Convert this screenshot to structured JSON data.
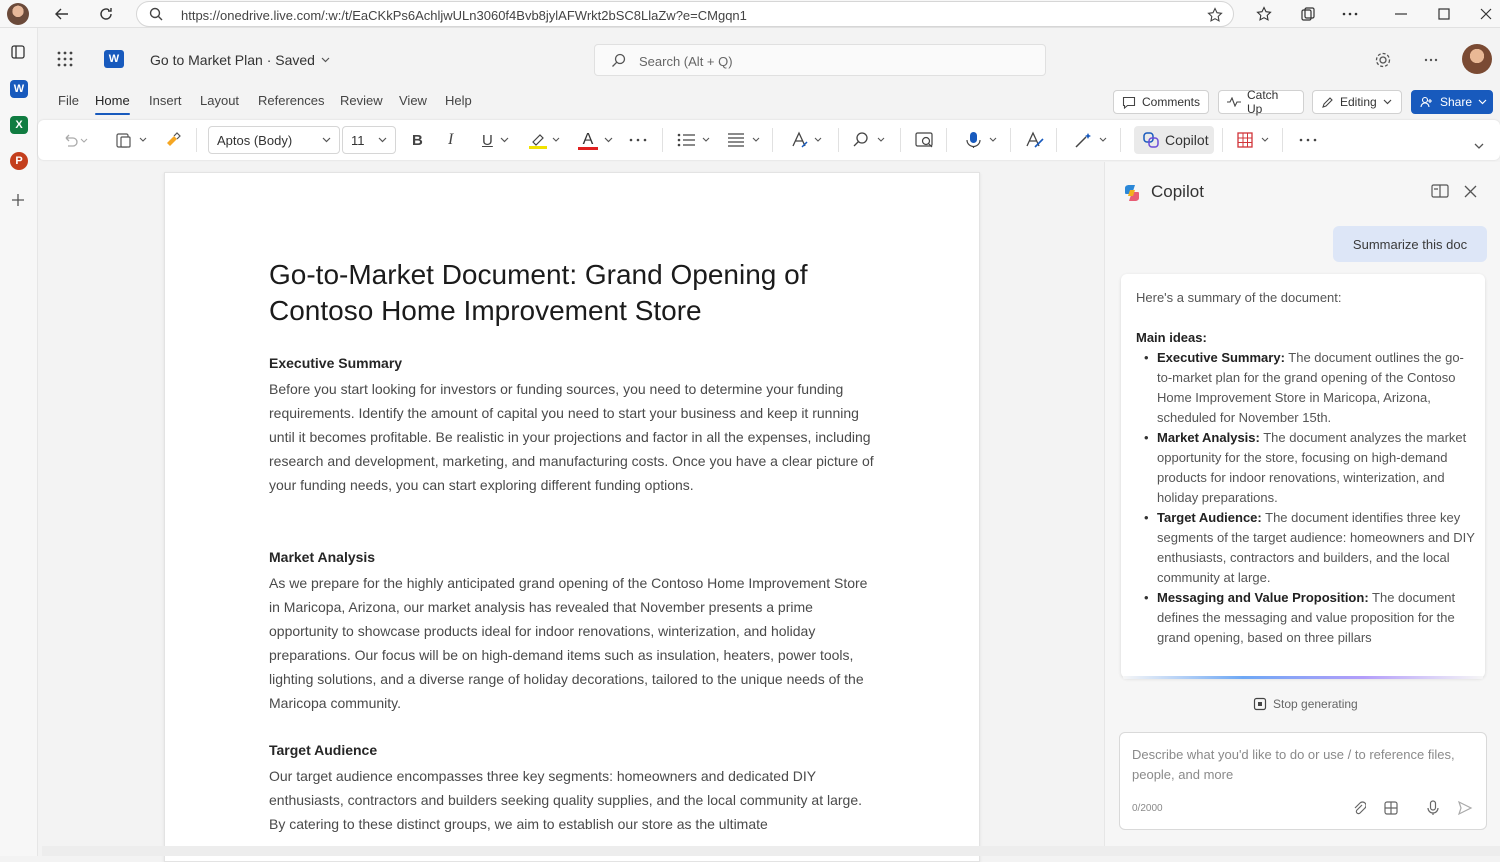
{
  "browser": {
    "url": "https://onedrive.live.com/:w:/t/EaCKkPs6AchljwULn3060f4Bvb8jylAFWrkt2bSC8LlaZw?e=CMgqn1"
  },
  "app": {
    "doc_title": "Go to Market Plan · Saved",
    "search_placeholder": "Search (Alt + Q)"
  },
  "menu": {
    "tabs": [
      "File",
      "Home",
      "Insert",
      "Layout",
      "References",
      "Review",
      "View",
      "Help"
    ],
    "active_tab": "Home",
    "comments": "Comments",
    "catchup": "Catch Up",
    "editing": "Editing",
    "share": "Share"
  },
  "ribbon": {
    "font": "Aptos (Body)",
    "size": "11",
    "bold": "B",
    "italic": "I",
    "underline": "U",
    "fontcolor": "A",
    "copilot": "Copilot"
  },
  "document": {
    "title": "Go-to-Market Document: Grand Opening of Contoso Home Improvement Store",
    "sections": [
      {
        "heading": "Executive Summary",
        "text": "Before you start looking for investors or funding sources, you need to determine your funding requirements. Identify the amount of capital you need to start your business and keep it running until it becomes profitable. Be realistic in your projections and factor in all the expenses, including research and development, marketing, and manufacturing costs. Once you have a clear picture of your funding needs, you can start exploring different funding options."
      },
      {
        "heading": "Market Analysis",
        "text": "As we prepare for the highly anticipated grand opening of the Contoso Home Improvement Store in Maricopa, Arizona, our market analysis has revealed that November presents a prime opportunity to showcase products ideal for indoor renovations, winterization, and holiday preparations. Our focus will be on high-demand items such as insulation, heaters, power tools, lighting solutions, and a diverse range of holiday decorations, tailored to the unique needs of the Maricopa community."
      },
      {
        "heading": "Target Audience",
        "text": "Our target audience encompasses three key segments: homeowners and dedicated DIY enthusiasts, contractors and builders seeking quality supplies, and the local community at large. By catering to these distinct groups, we aim to establish our store as the ultimate"
      }
    ]
  },
  "copilot": {
    "title": "Copilot",
    "prompt": "Summarize this doc",
    "intro": "Here's a summary of the document:",
    "main_ideas": "Main ideas:",
    "bullets": [
      {
        "label": "Executive Summary:",
        "text": " The document outlines the go-to-market plan for the grand opening of the Contoso Home Improvement Store in Maricopa, Arizona, scheduled for November 15th."
      },
      {
        "label": "Market Analysis:",
        "text": " The document analyzes the market opportunity for the store, focusing on high-demand products for indoor renovations, winterization, and holiday preparations."
      },
      {
        "label": "Target Audience:",
        "text": " The document identifies three key segments of the target audience: homeowners and DIY enthusiasts, contractors and builders, and the local community at large."
      },
      {
        "label": "Messaging and Value Proposition:",
        "text": " The document defines the messaging and value proposition for the grand opening, based on three pillars"
      }
    ],
    "stop": "Stop generating",
    "compose_placeholder": "Describe what you'd like to do or use / to reference files, people, and more",
    "counter": "0/2000"
  },
  "colors": {
    "accent": "#185abd",
    "excel": "#107c41",
    "powerpoint": "#c43e1c"
  }
}
